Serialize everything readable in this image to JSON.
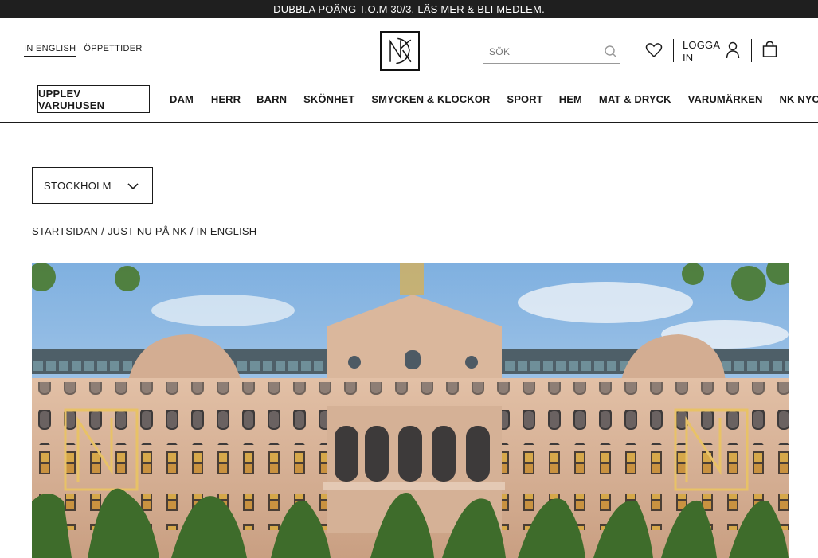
{
  "promo_bar": {
    "text": "DUBBLA POÄNG T.O.M 30/3.",
    "link": "LÄS MER & BLI MEDLEM",
    "suffix": "."
  },
  "utility": {
    "language": "IN ENGLISH",
    "hours": "ÖPPETTIDER"
  },
  "logo": {
    "text": "NK"
  },
  "search": {
    "placeholder": "SÖK",
    "icon": "search-icon"
  },
  "account": {
    "wishlist_icon": "heart-icon",
    "login_label": "LOGGA IN",
    "user_icon": "user-icon",
    "bag_icon": "shopping-bag-icon"
  },
  "nav": {
    "experience": "UPPLEV VARUHUSEN",
    "items": [
      "DAM",
      "HERR",
      "BARN",
      "SKÖNHET",
      "SMYCKEN & KLOCKOR",
      "SPORT",
      "HEM",
      "MAT & DRYCK",
      "VARUMÄRKEN",
      "NK NYCKELN"
    ]
  },
  "store_selector": {
    "value": "STOCKHOLM",
    "icon": "chevron-down-icon"
  },
  "breadcrumb": {
    "items": [
      "STARTSIDAN",
      "JUST NU PÅ NK",
      "IN ENGLISH"
    ],
    "separator": "/"
  },
  "colors": {
    "promo_bg": "#1f1f1f",
    "text": "#1a1a1a",
    "sky": "#8fb7e0",
    "facade": "#d9b59a",
    "roof": "#5b6f7a",
    "tree": "#3f6b2c"
  }
}
